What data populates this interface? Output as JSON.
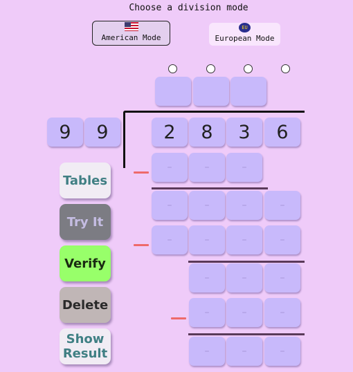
{
  "header": {
    "title": "Choose a division mode"
  },
  "modes": {
    "american": {
      "label": "American Mode",
      "icon": "us-flag-icon",
      "selected": true
    },
    "european": {
      "label": "European Mode",
      "icon": "eu-flag-icon",
      "badge": "EU",
      "selected": false
    }
  },
  "divisor": [
    "9",
    "9"
  ],
  "dividend": [
    "2",
    "8",
    "3",
    "6"
  ],
  "placeholder": "–",
  "buttons": {
    "tables": "Tables",
    "try_it": "Try It",
    "verify": "Verify",
    "delete": "Delete",
    "show_result": "Show Result"
  },
  "colors": {
    "background": "#efcbf9",
    "cell": "#c8b9fb",
    "minus_sign": "#ee6a6a",
    "verify": "#98ff6a",
    "try_it": "#7c7c83",
    "delete": "#c0b6b6"
  }
}
